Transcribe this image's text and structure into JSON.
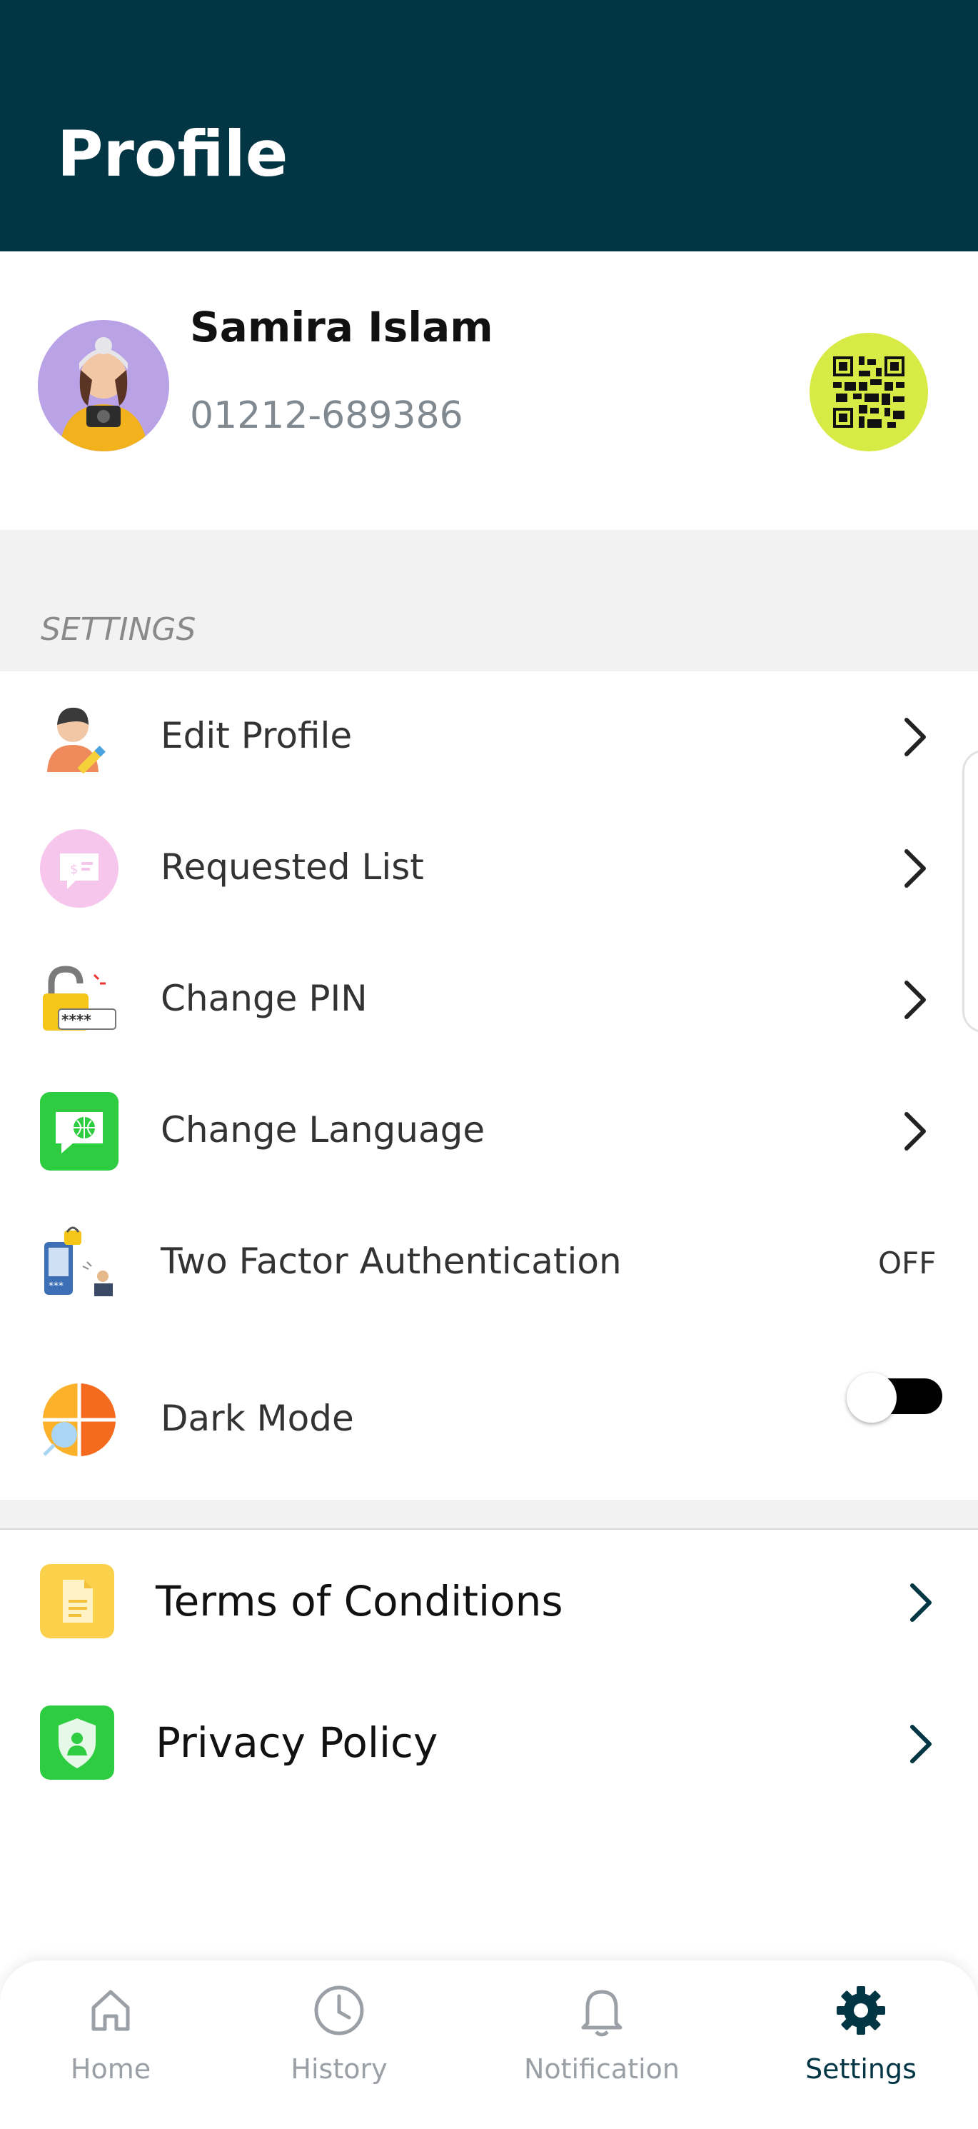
{
  "header": {
    "title": "Profile"
  },
  "user": {
    "name": "Samira Islam",
    "phone": "01212-689386"
  },
  "settings": {
    "section_label": "SETTINGS",
    "items": [
      {
        "label": "Edit Profile",
        "icon": "edit-profile-icon"
      },
      {
        "label": "Requested List",
        "icon": "requested-list-icon"
      },
      {
        "label": "Change PIN",
        "icon": "change-pin-icon"
      },
      {
        "label": "Change Language",
        "icon": "language-icon"
      },
      {
        "label": "Two Factor Authentication",
        "icon": "two-factor-icon",
        "state": "OFF"
      },
      {
        "label": "Dark Mode",
        "icon": "dark-mode-icon",
        "enabled": false
      }
    ]
  },
  "legal": {
    "items": [
      {
        "label": "Terms of Conditions",
        "icon": "document-icon"
      },
      {
        "label": "Privacy Policy",
        "icon": "shield-icon"
      }
    ]
  },
  "nav": {
    "items": [
      {
        "label": "Home",
        "icon": "home-icon"
      },
      {
        "label": "History",
        "icon": "clock-icon"
      },
      {
        "label": "Notification",
        "icon": "bell-icon"
      },
      {
        "label": "Settings",
        "icon": "gear-icon",
        "active": true
      }
    ]
  },
  "colors": {
    "header_bg": "#023645",
    "qr_bg": "#d7ea45",
    "active_nav": "#023645"
  }
}
